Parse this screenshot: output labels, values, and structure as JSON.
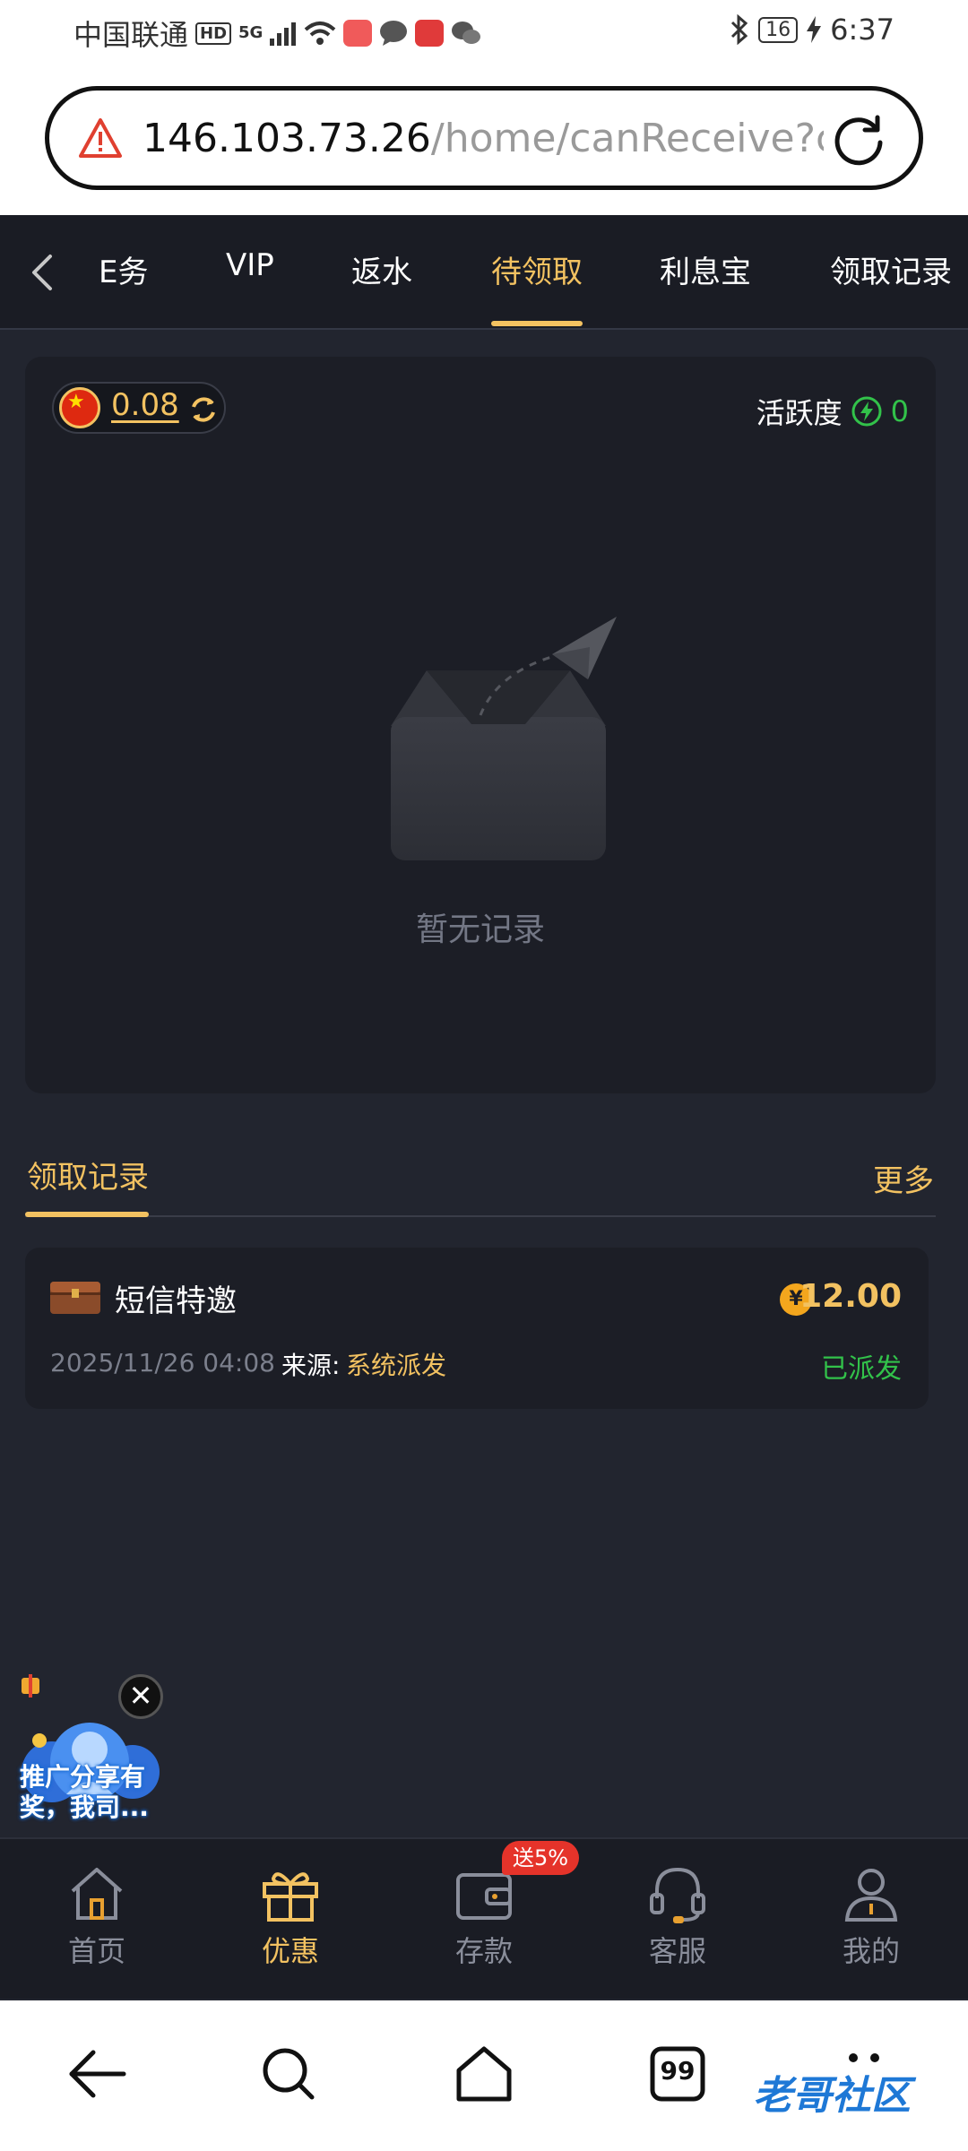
{
  "status_bar": {
    "carrier": "中国联通",
    "hd": "HD",
    "network": "5G",
    "battery": "16",
    "time": "6:37"
  },
  "address_bar": {
    "host": "146.103.73.26",
    "path": "/home/canReceive?c"
  },
  "tabs": [
    {
      "label": "E务"
    },
    {
      "label": "VIP"
    },
    {
      "label": "返水"
    },
    {
      "label": "待领取"
    },
    {
      "label": "利息宝"
    },
    {
      "label": "领取记录"
    }
  ],
  "active_tab": "待领取",
  "pending": {
    "balance": "0.08",
    "activity_label": "活跃度",
    "activity_value": "0",
    "empty_text": "暂无记录"
  },
  "records": {
    "title": "领取记录",
    "more": "更多",
    "items": [
      {
        "name": "短信特邀",
        "currency_symbol": "¥",
        "amount": "12.00",
        "time": "2025/11/26 04:08",
        "source_label": "来源:",
        "source": "系统派发",
        "status": "已派发"
      }
    ]
  },
  "promo": {
    "close": "✕",
    "text_line1": "推广分享有",
    "text_line2": "奖，我司..."
  },
  "bottom_nav": [
    {
      "label": "首页",
      "icon": "home-icon"
    },
    {
      "label": "优惠",
      "icon": "gift-icon"
    },
    {
      "label": "存款",
      "icon": "wallet-icon"
    },
    {
      "label": "客服",
      "icon": "headset-icon"
    },
    {
      "label": "我的",
      "icon": "user-icon"
    }
  ],
  "deposit_badge": "送5%",
  "system_nav": {
    "tab_count": "99",
    "watermark": "老哥社区"
  },
  "colors": {
    "accent": "#f3c261",
    "background": "#22252f",
    "card": "#1c1e26",
    "success": "#32c24a"
  }
}
